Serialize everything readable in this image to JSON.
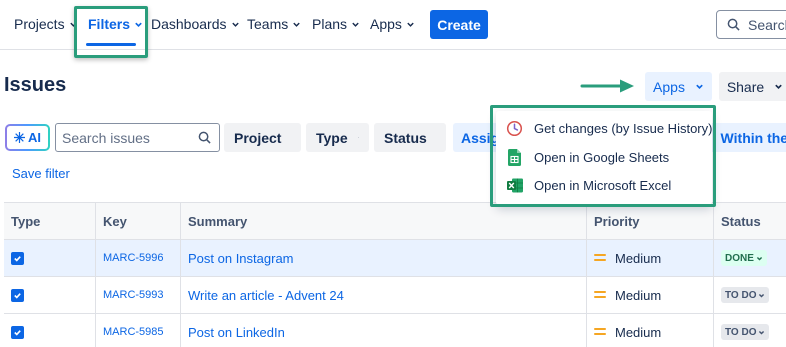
{
  "nav": {
    "items": [
      {
        "label": "Projects"
      },
      {
        "label": "Filters"
      },
      {
        "label": "Dashboards"
      },
      {
        "label": "Teams"
      },
      {
        "label": "Plans"
      },
      {
        "label": "Apps"
      }
    ],
    "create_label": "Create",
    "search_label": "Search"
  },
  "page": {
    "title": "Issues",
    "apps_label": "Apps",
    "share_label": "Share"
  },
  "filters": {
    "ai_label": "AI",
    "search_placeholder": "Search issues",
    "project_label": "Project",
    "type_label": "Type",
    "status_label": "Status",
    "assignee_partial": "Assig",
    "date_partial": ": Within the",
    "save_filter_label": "Save filter"
  },
  "apps_menu": {
    "items": [
      {
        "label": "Get changes (by Issue History)",
        "icon": "history-clock-icon"
      },
      {
        "label": "Open in Google Sheets",
        "icon": "google-sheets-icon"
      },
      {
        "label": "Open in Microsoft Excel",
        "icon": "excel-icon"
      }
    ]
  },
  "table": {
    "headers": [
      "Type",
      "Key",
      "Summary",
      "Priority",
      "Status"
    ],
    "rows": [
      {
        "key": "MARC-5996",
        "summary": "Post on Instagram",
        "priority": "Medium",
        "status": "DONE",
        "selected": true
      },
      {
        "key": "MARC-5993",
        "summary": "Write an article - Advent 24",
        "priority": "Medium",
        "status": "TO DO",
        "selected": false
      },
      {
        "key": "MARC-5985",
        "summary": "Post on LinkedIn",
        "priority": "Medium",
        "status": "TO DO",
        "selected": false
      }
    ]
  },
  "colors": {
    "accent": "#0c66e4",
    "highlight": "#2a9d7c",
    "priority_medium": "#f5a623",
    "done_bg": "#dcfff1",
    "done_text": "#216e4e"
  }
}
